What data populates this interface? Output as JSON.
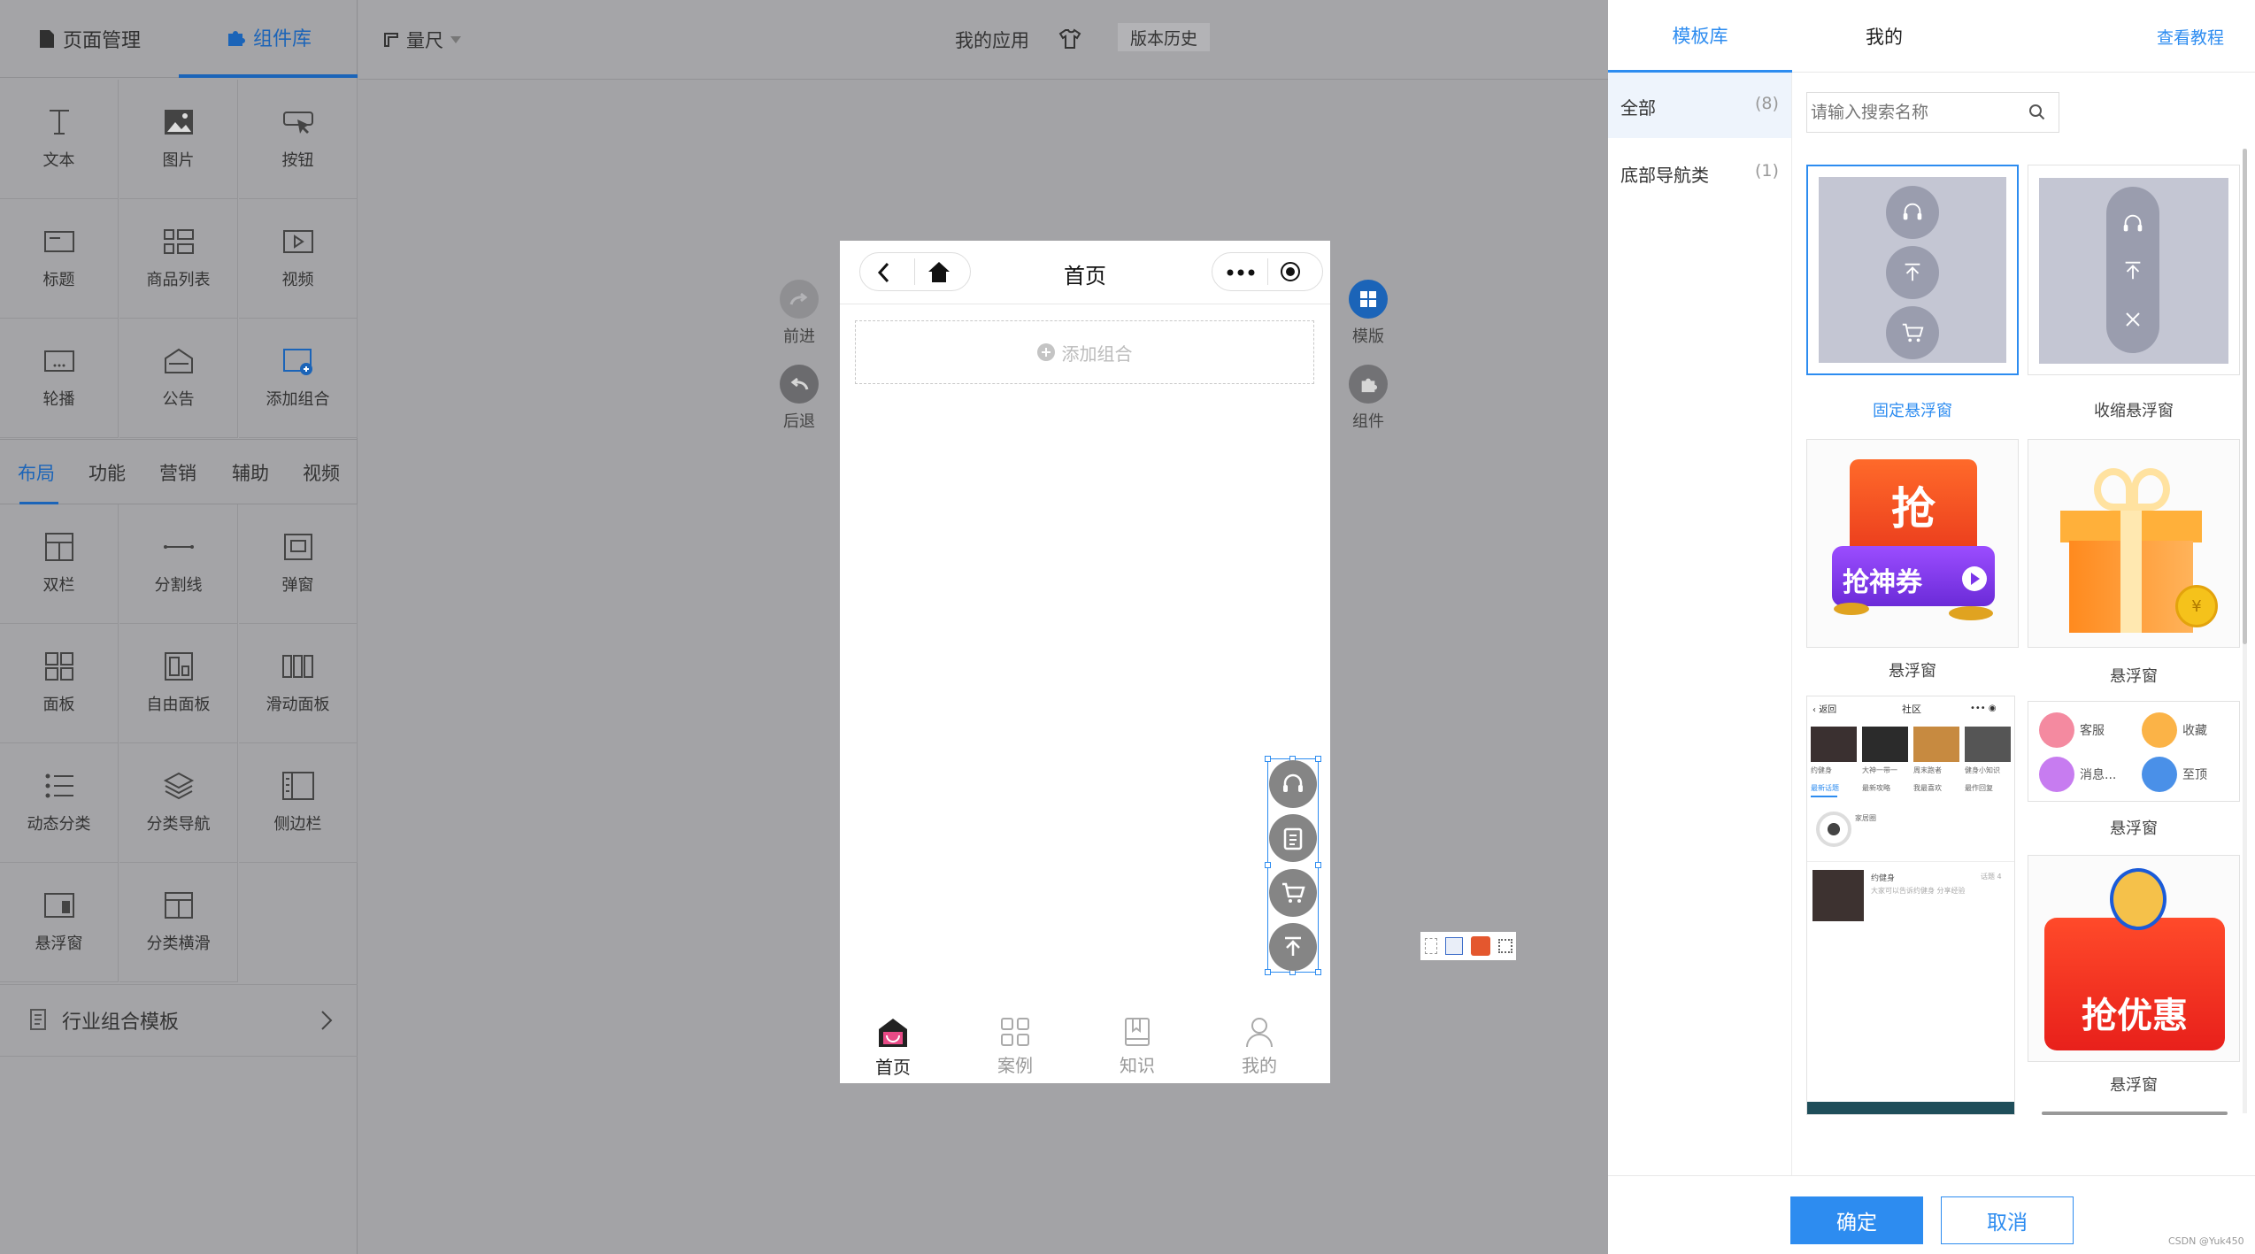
{
  "left_panel": {
    "tabs": [
      {
        "label": "页面管理"
      },
      {
        "label": "组件库"
      }
    ],
    "basic_items": [
      {
        "label": "文本"
      },
      {
        "label": "图片"
      },
      {
        "label": "按钮"
      },
      {
        "label": "标题"
      },
      {
        "label": "商品列表"
      },
      {
        "label": "视频"
      },
      {
        "label": "轮播"
      },
      {
        "label": "公告"
      },
      {
        "label": "添加组合"
      }
    ],
    "sub_tabs": [
      {
        "label": "布局"
      },
      {
        "label": "功能"
      },
      {
        "label": "营销"
      },
      {
        "label": "辅助"
      },
      {
        "label": "视频"
      }
    ],
    "layout_items": [
      {
        "label": "双栏"
      },
      {
        "label": "分割线"
      },
      {
        "label": "弹窗"
      },
      {
        "label": "面板"
      },
      {
        "label": "自由面板"
      },
      {
        "label": "滑动面板"
      },
      {
        "label": "动态分类"
      },
      {
        "label": "分类导航"
      },
      {
        "label": "侧边栏"
      },
      {
        "label": "悬浮窗"
      },
      {
        "label": "分类横滑"
      }
    ],
    "footer": {
      "label": "行业组合模板"
    }
  },
  "toolbar": {
    "ruler": "量尺",
    "app": "我的应用",
    "history": "版本历史"
  },
  "canvas": {
    "forward": "前进",
    "back": "后退",
    "template": "模版",
    "component": "组件",
    "phone": {
      "title": "首页",
      "add_group": "添加组合",
      "tabbar": [
        {
          "label": "首页"
        },
        {
          "label": "案例"
        },
        {
          "label": "知识"
        },
        {
          "label": "我的"
        }
      ]
    }
  },
  "right_panel": {
    "tabs": [
      {
        "label": "模板库"
      },
      {
        "label": "我的"
      }
    ],
    "tutorial": "查看教程",
    "categories": [
      {
        "label": "全部",
        "count": "(8)"
      },
      {
        "label": "底部导航类",
        "count": "(1)"
      }
    ],
    "search": {
      "placeholder": "请输入搜索名称"
    },
    "templates": [
      {
        "label": "固定悬浮窗"
      },
      {
        "label": "收缩悬浮窗"
      },
      {
        "label": "悬浮窗"
      },
      {
        "label": "悬浮窗"
      },
      {
        "label": "悬浮窗"
      },
      {
        "label": "悬浮窗"
      }
    ],
    "ticket_text": "抢",
    "ticket_sub": "抢神券",
    "promo_text": "抢优惠",
    "mini_nav": {
      "back": "返回",
      "title": "社区"
    },
    "mini_tabs": [
      "最新话题",
      "最新攻略",
      "我最喜欢",
      "最作回复"
    ],
    "mini_names": [
      "约健身",
      "大神一带一",
      "周末跑者",
      "健身小知识"
    ],
    "mini_section": "家居圈",
    "mini_post": {
      "user": "约健身",
      "time": "话题 4",
      "body": "大家可以告诉约健身 分享经验"
    },
    "float_menu": [
      {
        "label": "客服"
      },
      {
        "label": "收藏"
      },
      {
        "label": "消息..."
      },
      {
        "label": "至顶"
      }
    ],
    "confirm": "确定",
    "cancel": "取消",
    "watermark": "CSDN @Yuk450"
  },
  "colors": {
    "accent": "#1b64b8",
    "primary_button": "#2d8cf0"
  }
}
